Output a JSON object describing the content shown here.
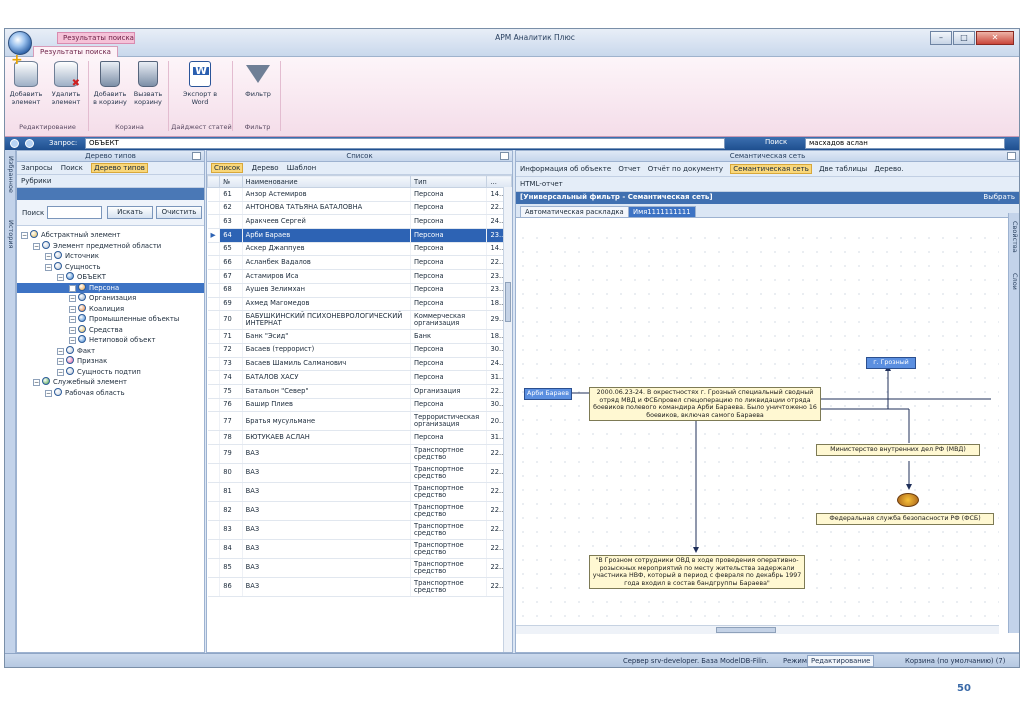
{
  "window": {
    "title": "АРМ Аналитик Плюс",
    "context_tab": "Результаты поиска",
    "ribbon_tab": "Результаты поиска"
  },
  "ribbon": {
    "add_element": "Добавить элемент",
    "delete_element": "Удалить элемент",
    "add_to_cart": "Добавить в корзину",
    "call_cart": "Вызвать корзину",
    "export_word": "Экспорт в Word",
    "filter": "Фильтр",
    "group_editing": "Редактирование",
    "group_cart": "Корзина",
    "group_digest": "Дайджест статей",
    "group_filter": "Фильтр"
  },
  "querybar": {
    "label": "Запрос:",
    "value": "ОБЪЕКТ",
    "search_label": "Поиск",
    "search_value": "масхадов аслан"
  },
  "sidestrip": {
    "favorites": "Избранное",
    "history": "История"
  },
  "tree_panel": {
    "title": "Дерево типов",
    "tabs": [
      "Запросы",
      "Поиск",
      "Дерево типов"
    ],
    "rubrics": "Рубрики",
    "search_label": "Поиск",
    "search_button": "Искать",
    "clear_button": "Очистить",
    "nodes": [
      {
        "label": "Абстрактный элемент",
        "level": 0,
        "ic": "#e2b84d"
      },
      {
        "label": "Элемент предметной области",
        "level": 1,
        "ic": "#b9c6d6"
      },
      {
        "label": "Источник",
        "level": 2,
        "ic": "#b9c6d6"
      },
      {
        "label": "Сущность",
        "level": 2,
        "ic": "#b9c6d6"
      },
      {
        "label": "ОБЪЕКТ",
        "level": 3,
        "ic": "#3f86d1"
      },
      {
        "label": "Персона",
        "level": 4,
        "ic": "#f1a23b",
        "selected": true
      },
      {
        "label": "Организация",
        "level": 4,
        "ic": "#8aa7c9"
      },
      {
        "label": "Коалиция",
        "level": 4,
        "ic": "#e77c2f"
      },
      {
        "label": "Промышленные объекты",
        "level": 4,
        "ic": "#3f86d1"
      },
      {
        "label": "Средства",
        "level": 4,
        "ic": "#e2b84d"
      },
      {
        "label": "Нетиповой объект",
        "level": 4,
        "ic": "#3f86d1"
      },
      {
        "label": "Факт",
        "level": 3,
        "ic": "#b9c6d6"
      },
      {
        "label": "Признак",
        "level": 3,
        "ic": "#e05ba0"
      },
      {
        "label": "Сущность подтип",
        "level": 3,
        "ic": "#b9c6d6"
      },
      {
        "label": "Служебный элемент",
        "level": 1,
        "ic": "#46a040"
      },
      {
        "label": "Рабочая область",
        "level": 2,
        "ic": "#c9d3e0"
      }
    ]
  },
  "list_panel": {
    "title": "Список",
    "tabs": [
      "Список",
      "Дерево",
      "Шаблон"
    ],
    "columns": [
      "№",
      "Наименование",
      "Тип",
      "..."
    ],
    "rows": [
      {
        "n": "61",
        "name": "Анзор Астемиров",
        "type": "Персона",
        "d": "14..."
      },
      {
        "n": "62",
        "name": "АНТОНОВА ТАТЬЯНА БАТАЛОВНА",
        "type": "Персона",
        "d": "22..."
      },
      {
        "n": "63",
        "name": "Аракчеев Сергей",
        "type": "Персона",
        "d": "24..."
      },
      {
        "n": "64",
        "name": "Арби Бараев",
        "type": "Персона",
        "d": "23...",
        "selected": true
      },
      {
        "n": "65",
        "name": "Аскер Джаппуев",
        "type": "Персона",
        "d": "14..."
      },
      {
        "n": "66",
        "name": "Асланбек Вадалов",
        "type": "Персона",
        "d": "22..."
      },
      {
        "n": "67",
        "name": "Астамиров Иса",
        "type": "Персона",
        "d": "23..."
      },
      {
        "n": "68",
        "name": "Аушев Зелимхан",
        "type": "Персона",
        "d": "23..."
      },
      {
        "n": "69",
        "name": "Ахмед Магомедов",
        "type": "Персона",
        "d": "18..."
      },
      {
        "n": "70",
        "name": "БАБУШКИНСКИЙ ПСИХОНЕВРОЛОГИЧЕСКИЙ ИНТЕРНАТ",
        "type": "Коммерческая организация",
        "d": "29..."
      },
      {
        "n": "71",
        "name": "Банк \"Эсид\"",
        "type": "Банк",
        "d": "18..."
      },
      {
        "n": "72",
        "name": "Басаев (террорист)",
        "type": "Персона",
        "d": "30..."
      },
      {
        "n": "73",
        "name": "Басаев Шамиль Салманович",
        "type": "Персона",
        "d": "24..."
      },
      {
        "n": "74",
        "name": "БАТАЛОВ ХАСУ",
        "type": "Персона",
        "d": "31..."
      },
      {
        "n": "75",
        "name": "Батальон \"Север\"",
        "type": "Организация",
        "d": "22..."
      },
      {
        "n": "76",
        "name": "Башир Плиев",
        "type": "Персона",
        "d": "30..."
      },
      {
        "n": "77",
        "name": "Братья мусульмане",
        "type": "Террористическая организация",
        "d": "20..."
      },
      {
        "n": "78",
        "name": "БЮТУКАЕВ АСЛАН",
        "type": "Персона",
        "d": "31..."
      },
      {
        "n": "79",
        "name": "ВАЗ",
        "type": "Транспортное средство",
        "d": "22..."
      },
      {
        "n": "80",
        "name": "ВАЗ",
        "type": "Транспортное средство",
        "d": "22..."
      },
      {
        "n": "81",
        "name": "ВАЗ",
        "type": "Транспортное средство",
        "d": "22..."
      },
      {
        "n": "82",
        "name": "ВАЗ",
        "type": "Транспортное средство",
        "d": "22..."
      },
      {
        "n": "83",
        "name": "ВАЗ",
        "type": "Транспортное средство",
        "d": "22..."
      },
      {
        "n": "84",
        "name": "ВАЗ",
        "type": "Транспортное средство",
        "d": "22..."
      },
      {
        "n": "85",
        "name": "ВАЗ",
        "type": "Транспортное средство",
        "d": "22..."
      },
      {
        "n": "86",
        "name": "ВАЗ",
        "type": "Транспортное средство",
        "d": "22..."
      }
    ]
  },
  "net_panel": {
    "title": "Семантическая сеть",
    "toolbar": [
      "Информация об объекте",
      "Отчет",
      "Отчёт по документу",
      "Семантическая сеть",
      "Две таблицы",
      "Дерево."
    ],
    "html_report": "HTML-отчет",
    "filter_title": "[Универсальный фильтр - Семантическая сеть]",
    "pick": "Выбрать",
    "tabs": [
      "Автоматическая раскладка",
      "Имя1111111111"
    ],
    "right_strip": [
      "Свойства",
      "Слои"
    ],
    "nodes": {
      "person": "Арби Бараев",
      "event1": "2000.06.23-24. В окрестностях г. Грозный специальный сводный отряд МВД и ФСБпровел спецоперацию по ликвидации отряда боевиков полевого командира Арби Бараева. Было уничтожено 16 боевиков, включая самого Бараева",
      "city": "г. Грозный",
      "mvd": "Министерство внутренних дел РФ (МВД)",
      "fsb": "Федеральная служба безопасности РФ (ФСБ)",
      "event2": "\"В Грозном сотрудники ОВД в ходе проведения оперативно-розыскных мероприятий по месту жительства задержали участника НВФ, который в период с февраля по декабрь 1997 года входил в состав бандгруппы Бараева\""
    }
  },
  "status": {
    "server": "Сервер srv-developer. База ModelDB-Filin.",
    "mode_label": "Режим",
    "mode": "Редактирование",
    "cart": "Корзина (по умолчанию) (7)"
  },
  "page_number": "50"
}
